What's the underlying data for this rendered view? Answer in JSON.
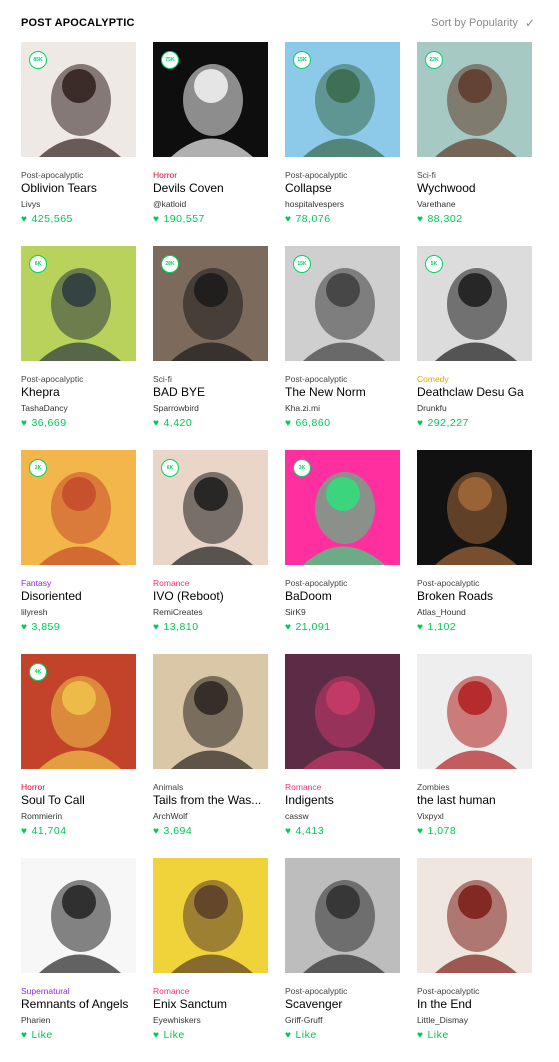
{
  "header": {
    "title": "POST APOCALYPTIC",
    "sort_label": "Sort by Popularity",
    "sort_icon": "check-icon"
  },
  "colors": {
    "accent": "#00c853",
    "Post-apocalyptic": "#444444",
    "Horror": "#e4003a",
    "Sci-fi": "#444444",
    "Comedy": "#e8a400",
    "Fantasy": "#8b2be2",
    "Romance": "#ff2d7a",
    "Animals": "#444444",
    "Supernatural": "#8b2be2",
    "Zombies": "#444444"
  },
  "series": [
    {
      "badge": "85K",
      "genre": "Post-apocalyptic",
      "title": "Oblivion Tears",
      "author": "Livys",
      "likes": "425,565",
      "bg": "#efe9e6",
      "fg": "#2e1e1b"
    },
    {
      "badge": "75K",
      "genre": "Horror",
      "title": "Devils Coven",
      "author": "@katloid",
      "likes": "190,557",
      "bg": "#0e0e0e",
      "fg": "#f5f5f5"
    },
    {
      "badge": "15K",
      "genre": "Post-apocalyptic",
      "title": "Collapse",
      "author": "hospitalvespers",
      "likes": "78,076",
      "bg": "#8dc9e8",
      "fg": "#3a6a4a"
    },
    {
      "badge": "22K",
      "genre": "Sci-fi",
      "title": "Wychwood",
      "author": "Varethane",
      "likes": "88,302",
      "bg": "#a7c9c4",
      "fg": "#5e3b2a"
    },
    {
      "badge": "6K",
      "genre": "Post-apocalyptic",
      "title": "Khepra",
      "author": "TashaDancy",
      "likes": "36,669",
      "bg": "#b8d25b",
      "fg": "#2b3940"
    },
    {
      "badge": "28K",
      "genre": "Sci-fi",
      "title": "BAD BYE",
      "author": "Sparrowbird",
      "likes": "4,420",
      "bg": "#7c6b5c",
      "fg": "#1a1a1a"
    },
    {
      "badge": "15K",
      "genre": "Post-apocalyptic",
      "title": "The New Norm",
      "author": "Kha.zi.mi",
      "likes": "66,860",
      "bg": "#cfcfcf",
      "fg": "#3d3d3d"
    },
    {
      "badge": "5K",
      "genre": "Comedy",
      "title": "Deathclaw Desu Ga",
      "author": "Drunkfu",
      "likes": "292,227",
      "bg": "#dcdcdc",
      "fg": "#1a1a1a"
    },
    {
      "badge": "2K",
      "genre": "Fantasy",
      "title": "Disoriented",
      "author": "lilyresh",
      "likes": "3,859",
      "bg": "#f3b64a",
      "fg": "#c44a2b"
    },
    {
      "badge": "6K",
      "genre": "Romance",
      "title": "IVO (Reboot)",
      "author": "RemiCreates",
      "likes": "13,810",
      "bg": "#e9d6c8",
      "fg": "#1b1b1b"
    },
    {
      "badge": "3K",
      "genre": "Post-apocalyptic",
      "title": "BaDoom",
      "author": "SirK9",
      "likes": "21,091",
      "bg": "#ff2fa0",
      "fg": "#2ee07a"
    },
    {
      "badge": "",
      "genre": "Post-apocalyptic",
      "title": "Broken Roads",
      "author": "Atlas_Hound",
      "likes": "1,102",
      "bg": "#111111",
      "fg": "#a36a3a"
    },
    {
      "badge": "4K",
      "genre": "Horror",
      "title": "Soul To Call",
      "author": "Rommierin",
      "likes": "41,704",
      "bg": "#c2432a",
      "fg": "#f0c44a"
    },
    {
      "badge": "",
      "genre": "Animals",
      "title": "Tails from the Was...",
      "author": "ArchWolf",
      "likes": "3,694",
      "bg": "#d9c7a8",
      "fg": "#2a2420"
    },
    {
      "badge": "",
      "genre": "Romance",
      "title": "Indigents",
      "author": "cassw",
      "likes": "4,413",
      "bg": "#5c2b45",
      "fg": "#c93b6b"
    },
    {
      "badge": "",
      "genre": "Zombies",
      "title": "the last human",
      "author": "Vixpyxl",
      "likes": "1,078",
      "bg": "#eeeeee",
      "fg": "#b01e1e"
    },
    {
      "badge": "",
      "genre": "Supernatural",
      "title": "Remnants of Angels",
      "author": "Pharien",
      "likes": "Like",
      "bg": "#f7f7f7",
      "fg": "#222222"
    },
    {
      "badge": "",
      "genre": "Romance",
      "title": "Enix Sanctum",
      "author": "Eyewhiskers",
      "likes": "Like",
      "bg": "#f0d23a",
      "fg": "#5a3d2a"
    },
    {
      "badge": "",
      "genre": "Post-apocalyptic",
      "title": "Scavenger",
      "author": "Griff-Gruff",
      "likes": "Like",
      "bg": "#bdbdbd",
      "fg": "#2e2e2e"
    },
    {
      "badge": "",
      "genre": "Post-apocalyptic",
      "title": "In the End",
      "author": "Little_Dismay",
      "likes": "Like",
      "bg": "#efe6e0",
      "fg": "#7a1b16"
    }
  ]
}
